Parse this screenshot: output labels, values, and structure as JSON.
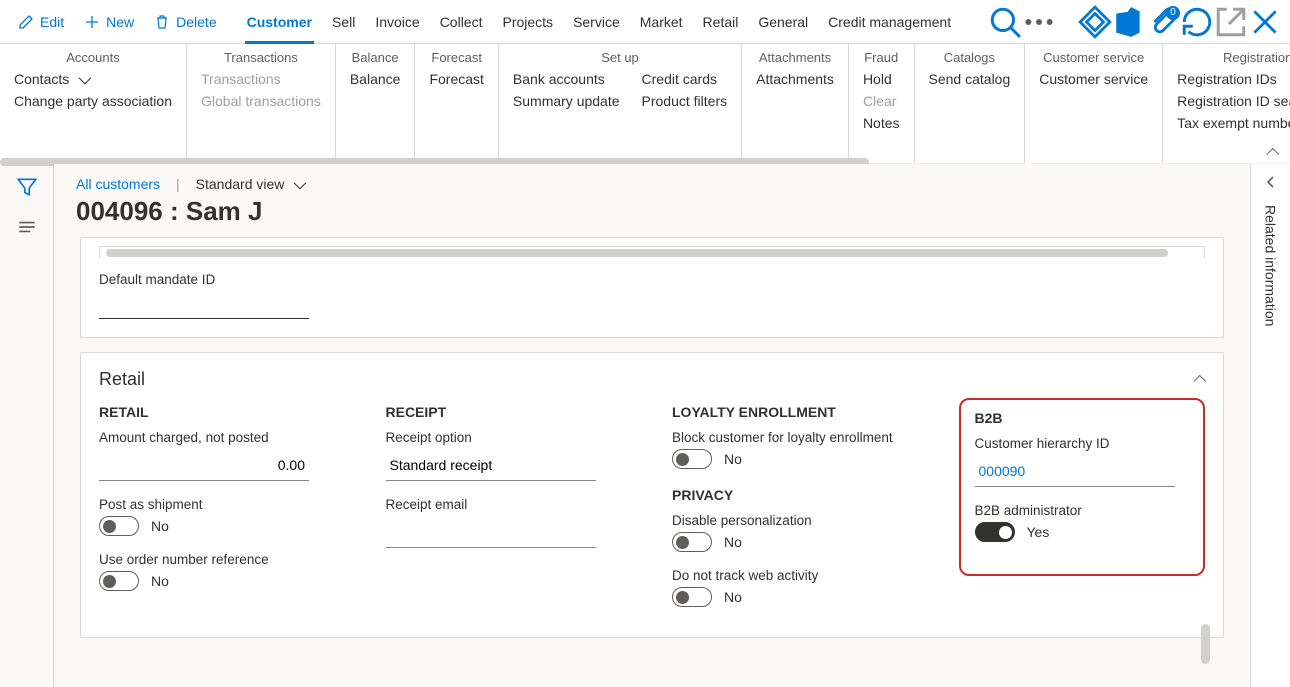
{
  "command": {
    "edit": "Edit",
    "new": "New",
    "delete": "Delete",
    "tabs": [
      "Customer",
      "Sell",
      "Invoice",
      "Collect",
      "Projects",
      "Service",
      "Market",
      "Retail",
      "General",
      "Credit management"
    ],
    "activeTab": 0,
    "notif_count": "0"
  },
  "ribbon": {
    "groups": [
      {
        "title": "Accounts",
        "cols": [
          [
            "Contacts",
            "Change party association"
          ]
        ]
      },
      {
        "title": "Transactions",
        "cols": [
          [
            "Transactions",
            "Global transactions"
          ]
        ],
        "disabled": true
      },
      {
        "title": "Balance",
        "cols": [
          [
            "Balance"
          ]
        ]
      },
      {
        "title": "Forecast",
        "cols": [
          [
            "Forecast"
          ]
        ]
      },
      {
        "title": "Set up",
        "cols": [
          [
            "Bank accounts",
            "Summary update"
          ],
          [
            "Credit cards",
            "Product filters"
          ]
        ]
      },
      {
        "title": "Attachments",
        "cols": [
          [
            "Attachments"
          ]
        ]
      },
      {
        "title": "Fraud",
        "cols": [
          [
            "Hold",
            "Clear",
            "Notes"
          ]
        ],
        "disabledIdx": [
          1
        ]
      },
      {
        "title": "Catalogs",
        "cols": [
          [
            "Send catalog"
          ]
        ]
      },
      {
        "title": "Customer service",
        "cols": [
          [
            "Customer service"
          ]
        ]
      },
      {
        "title": "Registration",
        "cols": [
          [
            "Registration IDs",
            "Registration ID search",
            "Tax exempt number searc"
          ]
        ]
      }
    ]
  },
  "breadcrumb": {
    "link": "All customers",
    "view": "Standard view"
  },
  "title": "004096 : Sam J",
  "mandate": {
    "label": "Default mandate ID",
    "value": ""
  },
  "retail": {
    "header": "Retail",
    "c1": {
      "name": "RETAIL",
      "amt_label": "Amount charged, not posted",
      "amt_value": "0.00",
      "ship_label": "Post as shipment",
      "ship_value": "No",
      "ord_label": "Use order number reference",
      "ord_value": "No"
    },
    "c2": {
      "name": "RECEIPT",
      "opt_label": "Receipt option",
      "opt_value": "Standard receipt",
      "mail_label": "Receipt email",
      "mail_value": ""
    },
    "c3": {
      "name1": "LOYALTY ENROLLMENT",
      "loy_label": "Block customer for loyalty enrollment",
      "loy_value": "No",
      "name2": "PRIVACY",
      "p1_label": "Disable personalization",
      "p1_value": "No",
      "p2_label": "Do not track web activity",
      "p2_value": "No"
    },
    "c4": {
      "name": "B2B",
      "id_label": "Customer hierarchy ID",
      "id_value": "000090",
      "adm_label": "B2B administrator",
      "adm_value": "Yes"
    }
  },
  "rightPanel": "Related information"
}
